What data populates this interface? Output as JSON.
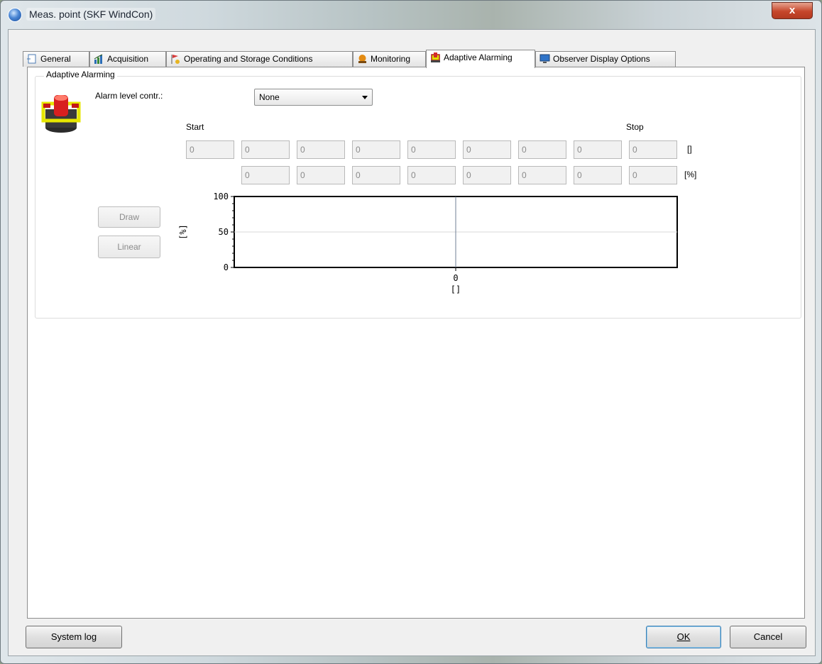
{
  "window": {
    "title": "Meas. point (SKF WindCon)",
    "close_glyph": "x"
  },
  "tabs": [
    {
      "label": "General",
      "icon": "general-page-icon"
    },
    {
      "label": "Acquisition",
      "icon": "acquisition-chart-icon"
    },
    {
      "label": "Operating and Storage Conditions",
      "icon": "conditions-flag-icon"
    },
    {
      "label": "Monitoring",
      "icon": "monitoring-alarm-icon"
    },
    {
      "label": "Adaptive Alarming",
      "icon": "adaptive-alarm-icon",
      "active": true
    },
    {
      "label": "Observer Display Options",
      "icon": "display-monitor-icon"
    }
  ],
  "group": {
    "title": "Adaptive Alarming",
    "alarm_level_label": "Alarm level contr.:",
    "alarm_level_value": "None",
    "start_label": "Start",
    "stop_label": "Stop",
    "row1": [
      "0",
      "0",
      "0",
      "0",
      "0",
      "0",
      "0",
      "0",
      "0"
    ],
    "row1_unit": "[]",
    "row2": [
      "0",
      "0",
      "0",
      "0",
      "0",
      "0",
      "0",
      "0"
    ],
    "row2_unit": "[%]",
    "draw_button": "Draw",
    "linear_button": "Linear"
  },
  "chart_data": {
    "type": "line",
    "ylabel": "[%]",
    "xlabel": "[]",
    "y_ticks": [
      "0",
      "50",
      "100"
    ],
    "ylim": [
      0,
      100
    ],
    "x_ticks": [
      "0"
    ],
    "x_marker": 0,
    "grid": "horizontal at 50"
  },
  "footer": {
    "system_log": "System log",
    "ok": "OK",
    "cancel": "Cancel"
  },
  "colors": {
    "accent": "#3c7fb1",
    "close": "#c6462b",
    "marker": "#6f7f95"
  }
}
